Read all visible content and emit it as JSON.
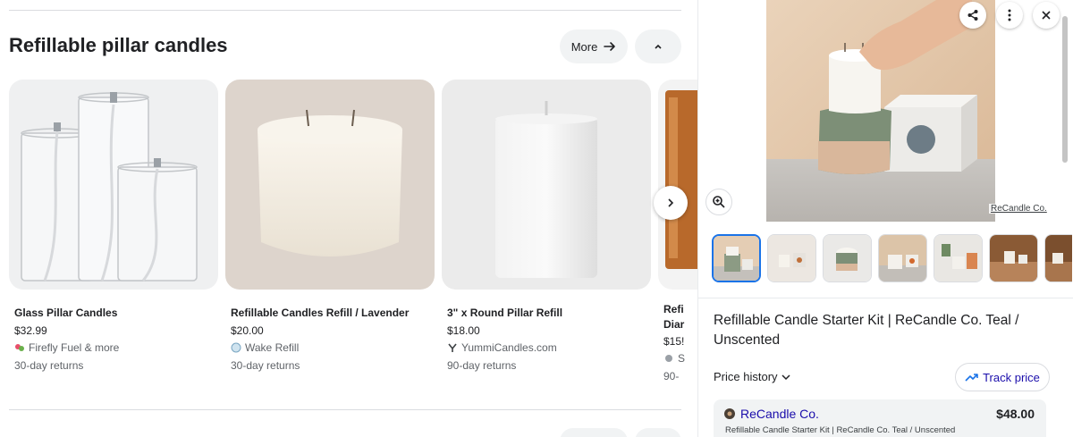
{
  "section": {
    "title": "Refillable pillar candles",
    "more_label": "More",
    "collapse_icon": "chevron-up-icon"
  },
  "products": [
    {
      "title": "Glass Pillar Candles",
      "price": "$32.99",
      "store": "Firefly Fuel & more",
      "returns": "30-day returns"
    },
    {
      "title": "Refillable Candles Refill / Lavender",
      "price": "$20.00",
      "store": "Wake Refill",
      "returns": "30-day returns"
    },
    {
      "title": "3\" x Round Pillar Refill",
      "price": "$18.00",
      "store": "YummiCandles.com",
      "returns": "90-day returns"
    },
    {
      "title": "Refi",
      "title2": "Diar",
      "price": "$15!",
      "store": "S",
      "returns": "90-"
    }
  ],
  "panel": {
    "image_credit": "ReCandle Co.",
    "product_title": "Refillable Candle Starter Kit | ReCandle Co. Teal / Unscented",
    "price_history_label": "Price history",
    "track_price_label": "Track price",
    "offer": {
      "seller": "ReCandle Co.",
      "price": "$48.00",
      "description": "Refillable Candle Starter Kit | ReCandle Co. Teal / Unscented"
    },
    "thumbnail_count": 7
  },
  "colors": {
    "link": "#1a0dab",
    "accent": "#1a73e8",
    "pill_bg": "#f1f3f4"
  }
}
